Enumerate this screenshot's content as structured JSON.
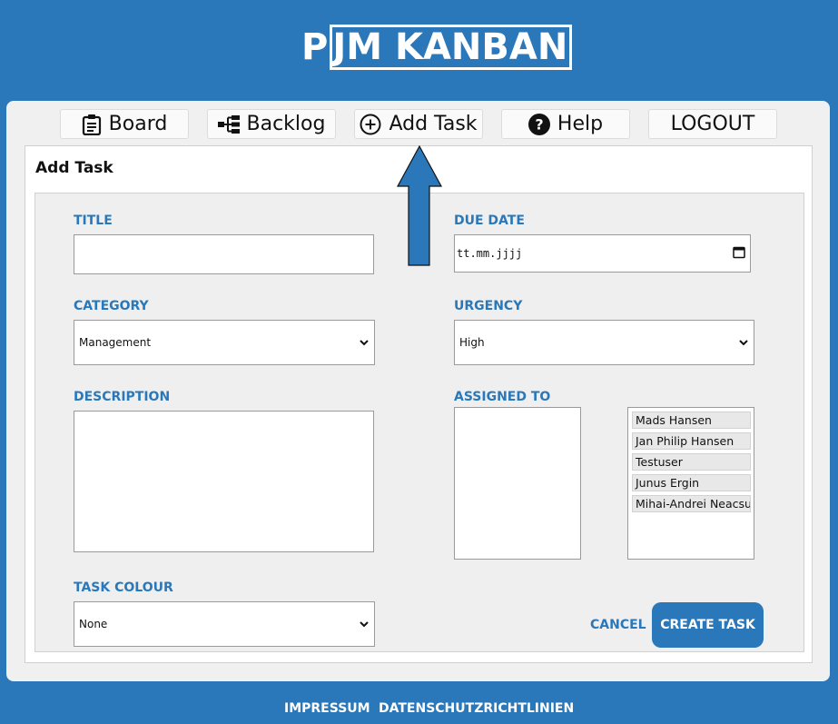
{
  "logo": {
    "text_p": "P",
    "text_rest": "JM KANBAN"
  },
  "nav": {
    "board": "Board",
    "backlog": "Backlog",
    "add_task": "Add Task",
    "help": "Help",
    "logout": "LOGOUT"
  },
  "panel": {
    "title": "Add Task"
  },
  "form": {
    "title_label": "TITLE",
    "title_value": "",
    "due_date_label": "DUE DATE",
    "due_date_placeholder": "tt.mm.jjjj",
    "category_label": "CATEGORY",
    "category_selected": "Management",
    "urgency_label": "URGENCY",
    "urgency_selected": "High",
    "description_label": "DESCRIPTION",
    "description_value": "",
    "assigned_label": "ASSIGNED TO",
    "available_users": [
      "Mads Hansen",
      "Jan Philip Hansen",
      "Testuser",
      "Junus Ergin",
      "Mihai-Andrei Neacsu"
    ],
    "task_colour_label": "TASK COLOUR",
    "task_colour_selected": "None",
    "cancel_label": "CANCEL",
    "create_label": "CREATE TASK"
  },
  "footer": {
    "impressum": "IMPRESSUM",
    "privacy": "DATENSCHUTZRICHTLINIEN"
  },
  "colors": {
    "brand": "#2a78b9",
    "background": "#2a78b9",
    "card": "#f0f0f0"
  }
}
